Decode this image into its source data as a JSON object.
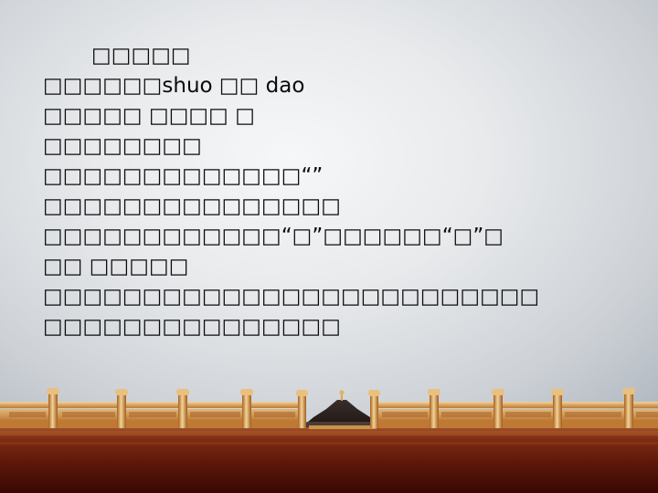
{
  "slide": {
    "lines": [
      "□□□□□",
      "□□□□□□shuo □□ dao",
      "□□□□□ □□□□ □",
      "□□□□□□□□",
      "□□□□□□□□□□□□□“”",
      "□□□□□□□□□□□□□□□",
      "□□□□□□□□□□□□“□”□□□□□□“□”□",
      "□□ □□□□□",
      "□□□□□□□□□□□□□□□□□□□□□□□□□",
      "□□□□□□□□□□□□□□□"
    ]
  },
  "colors": {
    "text": "#0b0b0b",
    "background_center": "#f6f7f8",
    "background_edge": "#b2b9c1",
    "balustrade_gold": "#d6a262",
    "courtyard_red": "#7a2a12",
    "temple_roof": "#2b201e"
  }
}
